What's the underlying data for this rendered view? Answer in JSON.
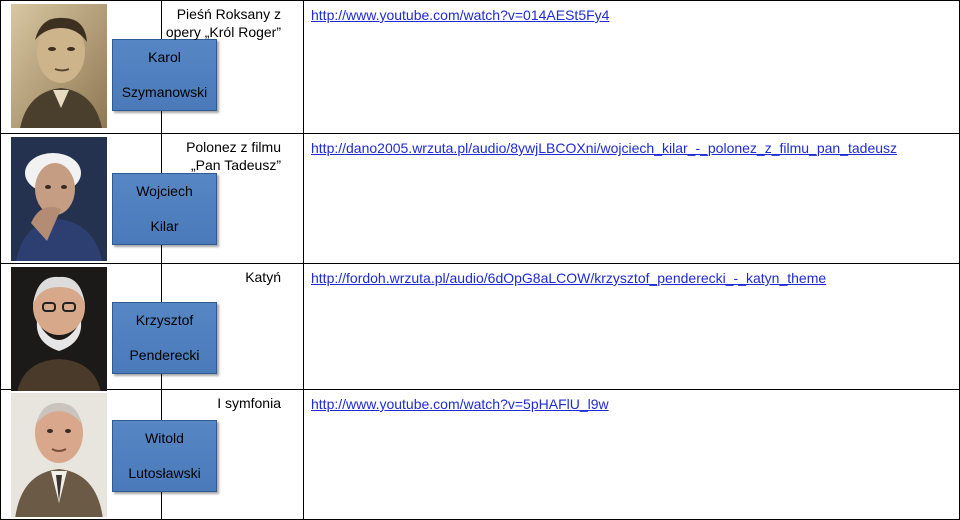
{
  "rows": [
    {
      "first_name": "Karol",
      "last_name": "Szymanowski",
      "work_line1": "Pieśń Roksany z",
      "work_line2": "opery „Król Roger”",
      "link": "http://www.youtube.com/watch?v=014AESt5Fy4"
    },
    {
      "first_name": "Wojciech",
      "last_name": "Kilar",
      "work_line1": "Polonez z filmu",
      "work_line2": "„Pan Tadeusz”",
      "link": "http://dano2005.wrzuta.pl/audio/8ywjLBCOXni/wojciech_kilar_-_polonez_z_filmu_pan_tadeusz"
    },
    {
      "first_name": "Krzysztof",
      "last_name": "Penderecki",
      "work_line1": "Katyń",
      "work_line2": "",
      "link": "http://fordoh.wrzuta.pl/audio/6dOpG8aLCOW/krzysztof_penderecki_-_katyn_theme"
    },
    {
      "first_name": "Witold",
      "last_name": "Lutosławski",
      "work_line1": "I symfonia",
      "work_line2": "",
      "link": "http://www.youtube.com/watch?v=5pHAFlU_l9w"
    }
  ],
  "colors": {
    "link": "#1f2bd6",
    "namebox": "#4f80bf"
  }
}
